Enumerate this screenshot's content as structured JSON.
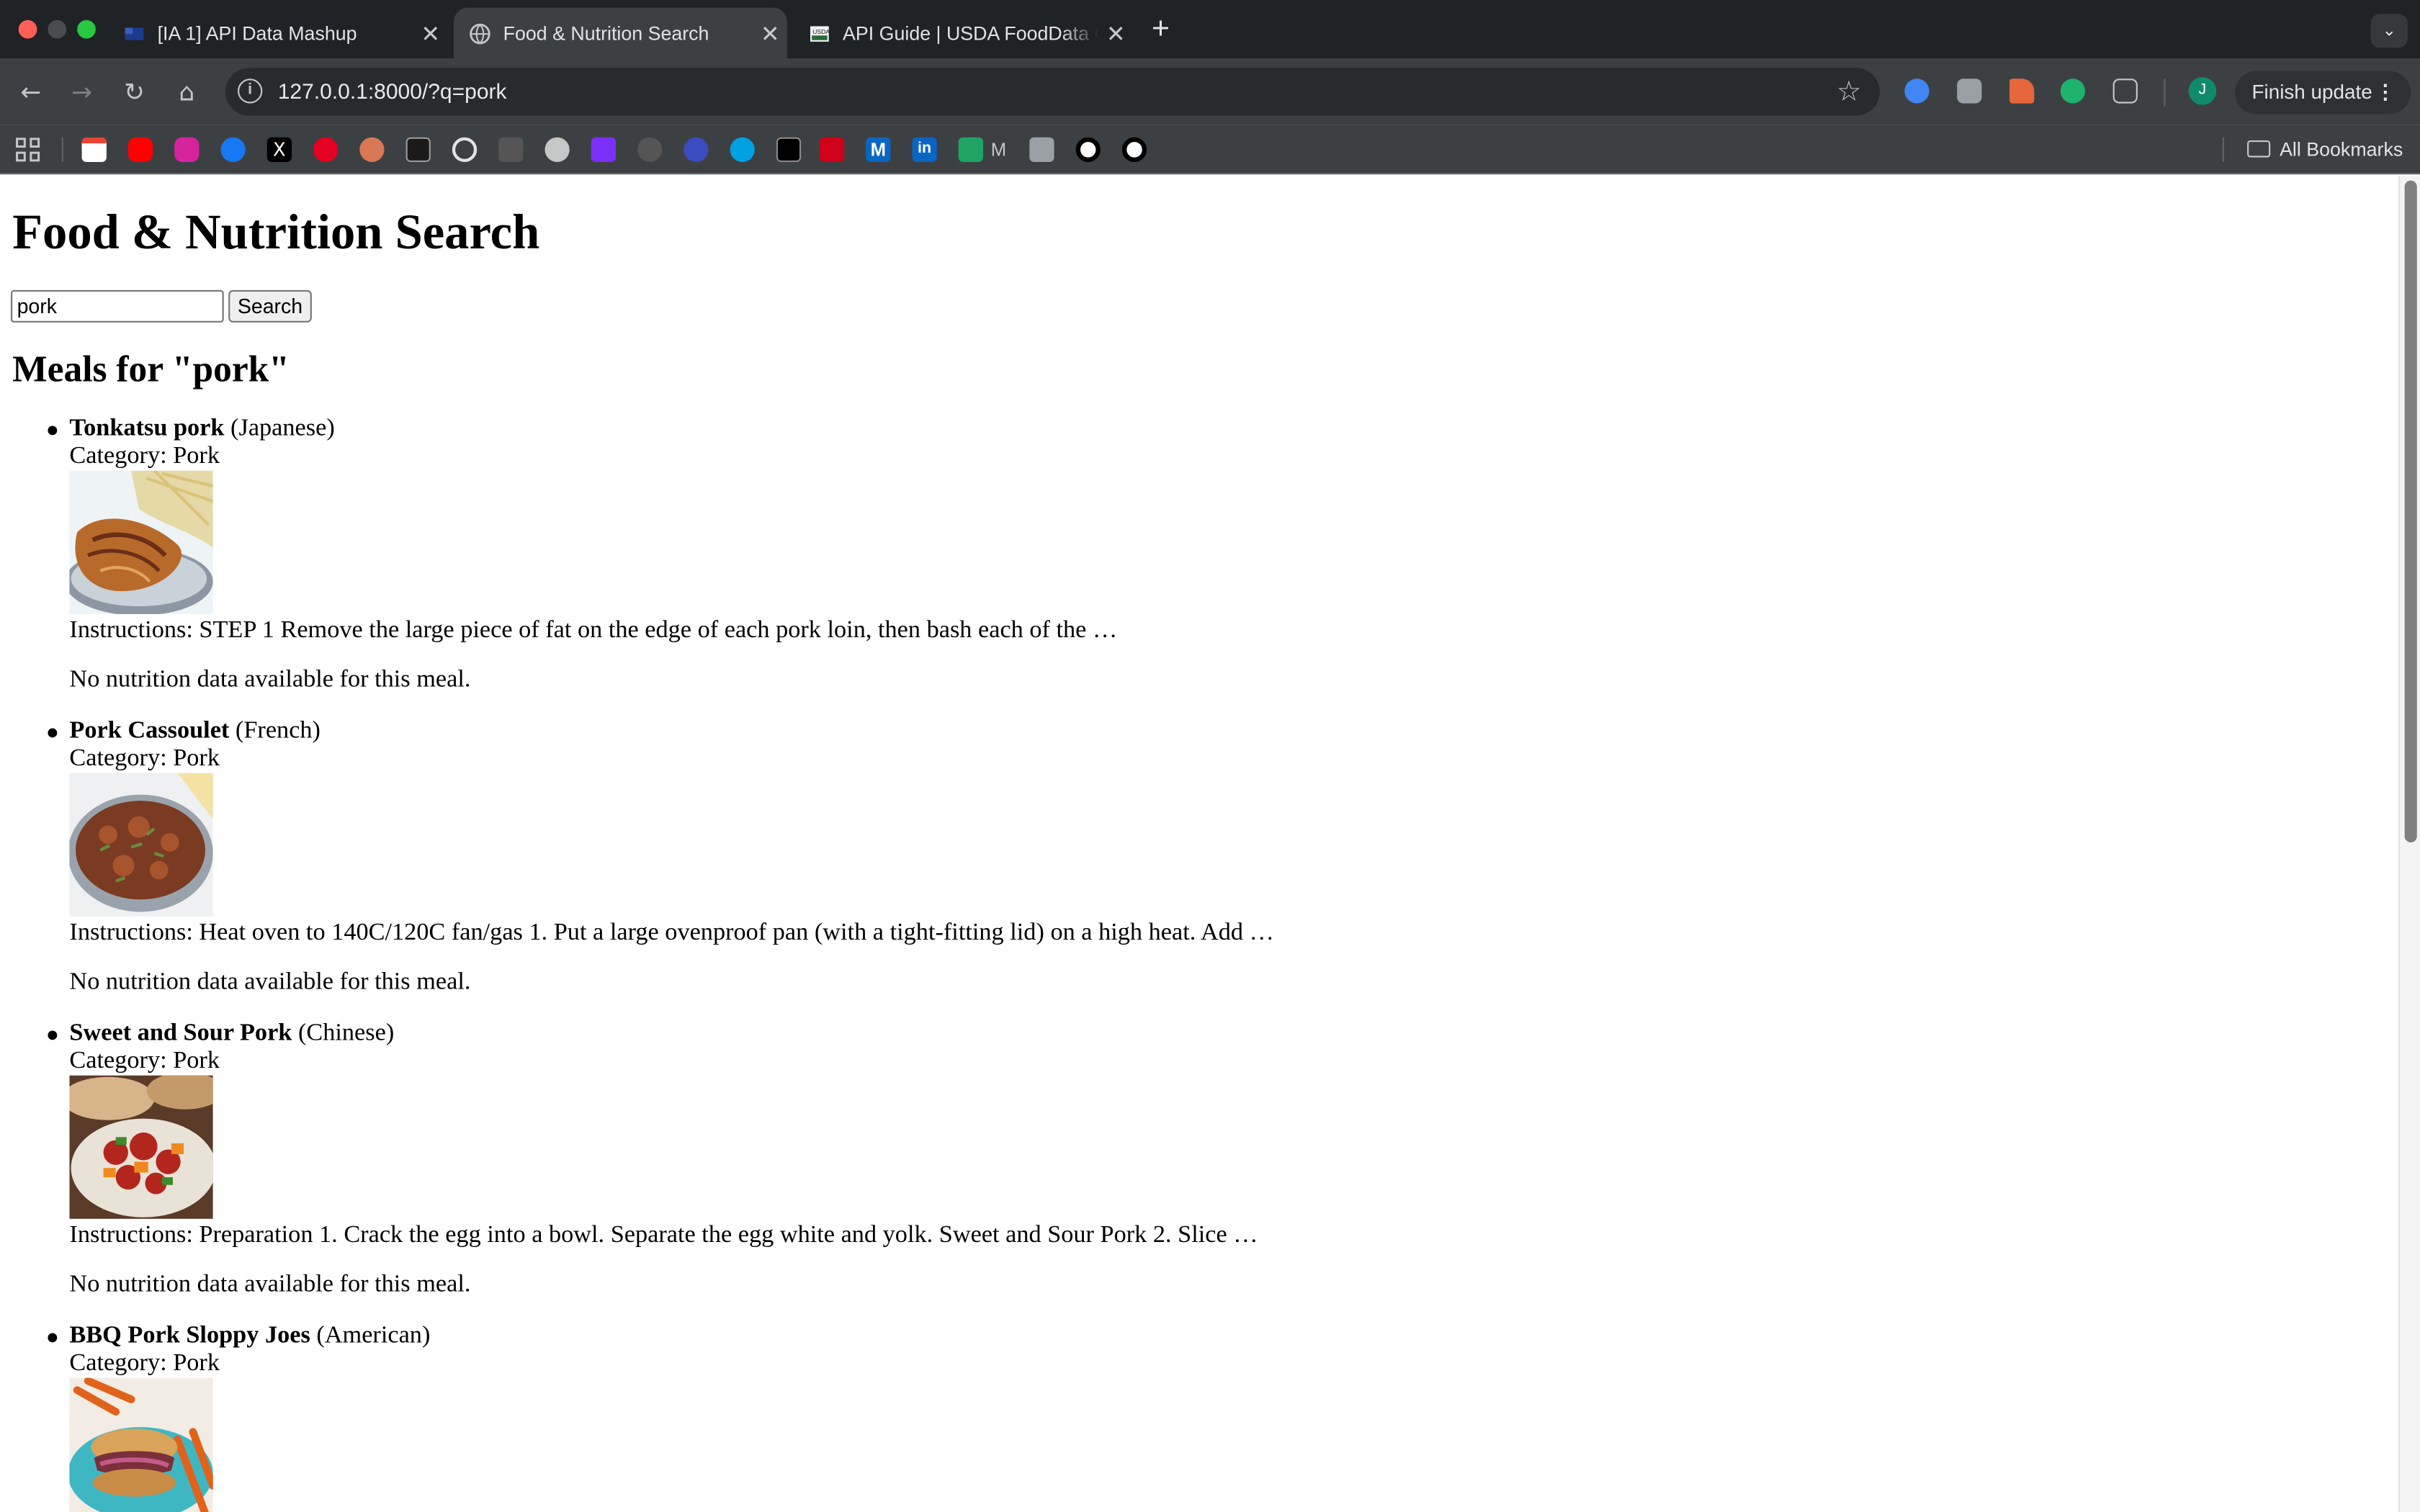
{
  "browser": {
    "tabs": [
      {
        "title": "[IA 1] API Data Mashup",
        "active": false
      },
      {
        "title": "Food & Nutrition Search",
        "active": true
      },
      {
        "title": "API Guide | USDA FoodData C",
        "active": false
      }
    ],
    "url": "127.0.0.1:8000/?q=pork",
    "finish_update": "Finish update",
    "profile_initial": "J",
    "all_bookmarks": "All Bookmarks",
    "bookmark_letter": "M"
  },
  "page": {
    "title": "Food & Nutrition Search",
    "search_value": "pork",
    "search_button": "Search",
    "results_heading": "Meals for \"pork\""
  },
  "meals": [
    {
      "name": "Tonkatsu pork",
      "area": "(Japanese)",
      "category": "Category: Pork",
      "instructions": "Instructions: STEP 1 Remove the large piece of fat on the edge of each pork loin, then bash each of the …",
      "nutrition": "No nutrition data available for this meal."
    },
    {
      "name": "Pork Cassoulet",
      "area": "(French)",
      "category": "Category: Pork",
      "instructions": "Instructions: Heat oven to 140C/120C fan/gas 1. Put a large ovenproof pan (with a tight-fitting lid) on a high heat. Add …",
      "nutrition": "No nutrition data available for this meal."
    },
    {
      "name": "Sweet and Sour Pork",
      "area": "(Chinese)",
      "category": "Category: Pork",
      "instructions": "Instructions: Preparation 1. Crack the egg into a bowl. Separate the egg white and yolk. Sweet and Sour Pork 2. Slice …",
      "nutrition": "No nutrition data available for this meal."
    },
    {
      "name": "BBQ Pork Sloppy Joes",
      "area": "(American)",
      "category": "Category: Pork"
    }
  ]
}
